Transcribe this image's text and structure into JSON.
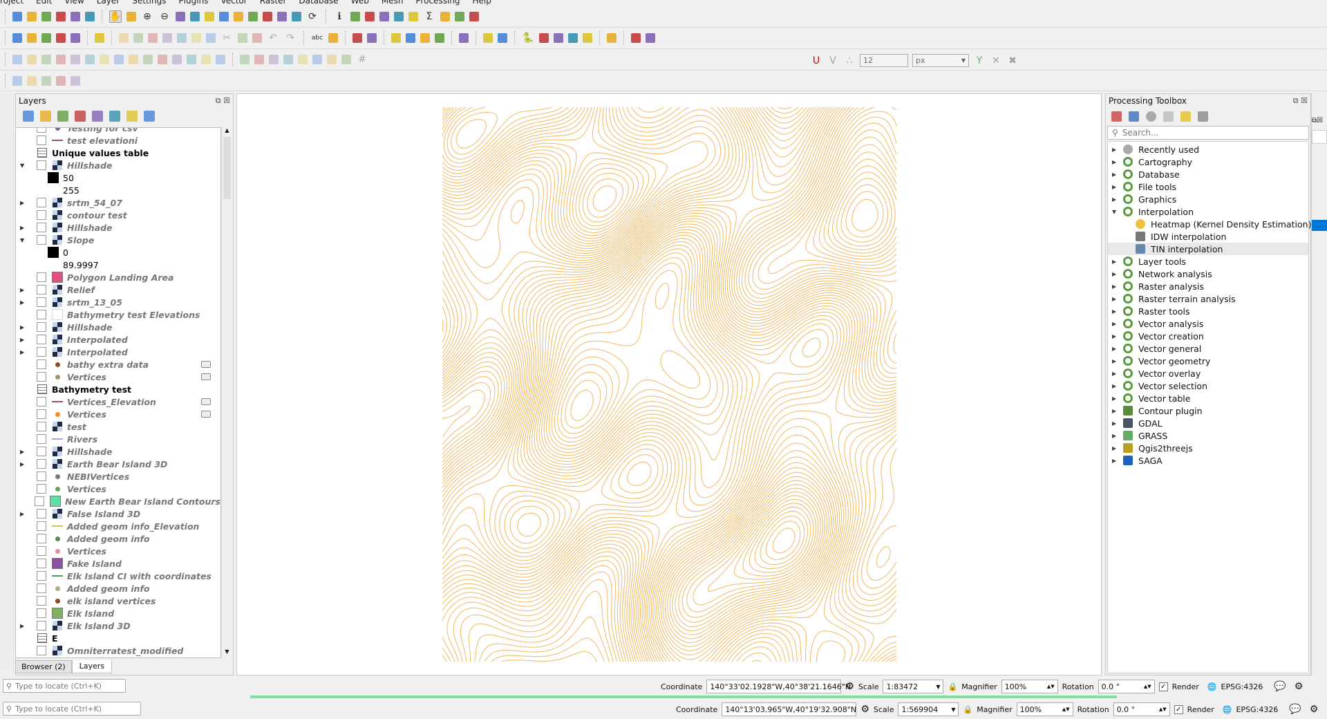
{
  "menu": [
    "roject",
    "Edit",
    "View",
    "Layer",
    "Settings",
    "Plugins",
    "Vector",
    "Raster",
    "Database",
    "Web",
    "Mesh",
    "Processing",
    "Help"
  ],
  "toolbars": {
    "row1": [
      "new-project",
      "open-project",
      "save-project",
      "save-as",
      "print-layout",
      "style-manager",
      "|",
      "pan-hand",
      "pan-to-selection",
      "zoom-in",
      "zoom-out",
      "zoom-full",
      "zoom-selection",
      "zoom-layer",
      "zoom-native",
      "zoom-last",
      "zoom-next",
      "new-bookmark",
      "show-bookmarks",
      "temporal",
      "refresh",
      "|",
      "identify",
      "actions",
      "select-features",
      "open-attribute-table",
      "deselect",
      "statistics",
      "sum",
      "measure",
      "map-tips",
      "text-annotation"
    ],
    "row2": [
      "data-source-manager",
      "new-geopackage",
      "new-vector",
      "digitize",
      "new-temp-layer",
      "|",
      "georeferencer",
      "|",
      "current-edits",
      "toggle-editing",
      "save-edits",
      "add-feature",
      "vertex-tool",
      "modify-attributes",
      "delete-selected",
      "cut",
      "copy",
      "paste",
      "undo",
      "redo",
      "|",
      "label",
      "diagram",
      "|",
      "pin-labels",
      "show-hide-labels",
      "|",
      "move-label",
      "rotate-label",
      "change-label",
      "label-properties",
      "|",
      "db-manager",
      "|",
      "qgis2threejs",
      "3d-view",
      "|",
      "python",
      "processing",
      "grass",
      "globe",
      "osm-place",
      "|",
      "info",
      "|",
      "coordinate-capture",
      "gps"
    ],
    "row3": [
      "advanced-digitize",
      "vertex",
      "reshape",
      "offset",
      "split",
      "merge",
      "rotate",
      "simplify",
      "add-ring",
      "add-part",
      "fill-ring",
      "delete-ring",
      "delete-part",
      "split-parts",
      "reverse",
      "|",
      "align",
      "align-right",
      "align-left",
      "align-text",
      "light",
      "light2",
      "highlight",
      "highlight2",
      "grid"
    ],
    "row3_right": {
      "tool_icons": [
        "snapping-magnet",
        "snap-vertex",
        "snap-tolerance"
      ],
      "tolerance": "12",
      "unit": "px",
      "extra_icons": [
        "topology",
        "intersection",
        "trace"
      ]
    },
    "row4": [
      "select-tool",
      "select-radius",
      "select-polygon",
      "select-freehand",
      "select-value"
    ]
  },
  "layers_panel": {
    "title": "Layers",
    "tool_icons": [
      "style-brush",
      "add-group",
      "manage-visibility",
      "filter",
      "expression-filter",
      "expand-all",
      "collapse-all",
      "remove-layer"
    ],
    "items": [
      {
        "name": "Testing for csv",
        "type": "point",
        "color": "#8060a8",
        "expand": ""
      },
      {
        "name": "test elevationi",
        "type": "line",
        "color": "#a05050",
        "expand": ""
      },
      {
        "name": "Unique values table",
        "type": "group",
        "color": "",
        "expand": ""
      },
      {
        "name": "Hillshade",
        "type": "raster",
        "color": "",
        "expand": "open"
      },
      {
        "name": "50",
        "type": "legend",
        "color": "#000000",
        "expand": ""
      },
      {
        "name": "255",
        "type": "legend",
        "color": "#ffffff",
        "expand": ""
      },
      {
        "name": "srtm_54_07",
        "type": "raster",
        "color": "",
        "expand": "closed"
      },
      {
        "name": "contour test",
        "type": "raster",
        "color": "",
        "expand": ""
      },
      {
        "name": "Hillshade",
        "type": "raster",
        "color": "",
        "expand": "closed"
      },
      {
        "name": "Slope",
        "type": "raster",
        "color": "",
        "expand": "open"
      },
      {
        "name": "0",
        "type": "legend",
        "color": "#000000",
        "expand": ""
      },
      {
        "name": "89.9997",
        "type": "legend",
        "color": "#ffffff",
        "expand": ""
      },
      {
        "name": "Polygon Landing Area",
        "type": "polygon",
        "color": "#e05080",
        "expand": ""
      },
      {
        "name": "Relief",
        "type": "raster",
        "color": "",
        "expand": "closed"
      },
      {
        "name": "srtm_13_05",
        "type": "raster",
        "color": "",
        "expand": "closed"
      },
      {
        "name": "Bathymetry test Elevations",
        "type": "empty",
        "color": "",
        "expand": ""
      },
      {
        "name": "Hillshade",
        "type": "raster",
        "color": "",
        "expand": "closed"
      },
      {
        "name": "Interpolated",
        "type": "raster",
        "color": "",
        "expand": "closed"
      },
      {
        "name": "Interpolated",
        "type": "raster",
        "color": "",
        "expand": "closed"
      },
      {
        "name": "bathy extra data",
        "type": "point",
        "color": "#8a4a2a",
        "expand": "",
        "editable": true
      },
      {
        "name": "Vertices",
        "type": "point",
        "color": "#a09080",
        "expand": "",
        "editable": true
      },
      {
        "name": "Bathymetry test",
        "type": "group",
        "color": "",
        "expand": ""
      },
      {
        "name": "Vertices_Elevation",
        "type": "line",
        "color": "#a05050",
        "expand": "",
        "editable": true
      },
      {
        "name": "Vertices",
        "type": "point",
        "color": "#f09020",
        "expand": "",
        "editable": true
      },
      {
        "name": "test",
        "type": "raster",
        "color": "",
        "expand": ""
      },
      {
        "name": "Rivers",
        "type": "line",
        "color": "#9aaae0",
        "expand": ""
      },
      {
        "name": "Hillshade",
        "type": "raster",
        "color": "",
        "expand": "closed"
      },
      {
        "name": "Earth Bear Island 3D",
        "type": "raster",
        "color": "",
        "expand": "closed"
      },
      {
        "name": "NEBIVertices",
        "type": "point",
        "color": "#708070",
        "expand": ""
      },
      {
        "name": "Vertices",
        "type": "point",
        "color": "#70a060",
        "expand": ""
      },
      {
        "name": "New Earth Bear Island Contours",
        "type": "polygon",
        "color": "#60e0a0",
        "expand": ""
      },
      {
        "name": "False Island 3D",
        "type": "raster",
        "color": "",
        "expand": "closed"
      },
      {
        "name": "Added geom info_Elevation",
        "type": "line",
        "color": "#d0c050",
        "expand": ""
      },
      {
        "name": "Added geom info",
        "type": "point",
        "color": "#608060",
        "expand": ""
      },
      {
        "name": "Vertices",
        "type": "point",
        "color": "#e090a0",
        "expand": ""
      },
      {
        "name": "Fake Island",
        "type": "polygon",
        "color": "#9050a0",
        "expand": ""
      },
      {
        "name": "Elk Island CI with coordinates",
        "type": "line",
        "color": "#50a050",
        "expand": ""
      },
      {
        "name": "Added geom info",
        "type": "point",
        "color": "#b0a890",
        "expand": ""
      },
      {
        "name": "elk island vertices",
        "type": "point",
        "color": "#8a4a20",
        "expand": ""
      },
      {
        "name": "Elk Island",
        "type": "polygon",
        "color": "#80b060",
        "expand": ""
      },
      {
        "name": "Elk Island 3D",
        "type": "raster",
        "color": "",
        "expand": "closed"
      },
      {
        "name": "E",
        "type": "group",
        "color": "",
        "expand": ""
      },
      {
        "name": "Omniterratest_modified",
        "type": "raster",
        "color": "",
        "expand": ""
      }
    ],
    "tabs": [
      "Browser (2)",
      "Layers"
    ],
    "active_tab": "Layers"
  },
  "map": {
    "contour_color": "#f0b860"
  },
  "toolbox": {
    "title": "Processing Toolbox",
    "tool_icons": [
      "models",
      "python-scripts",
      "history",
      "results",
      "edit-features-in-place",
      "options"
    ],
    "search_placeholder": "Search...",
    "items": [
      {
        "label": "Recently used",
        "icon": "clock",
        "expand": "closed",
        "level": 0
      },
      {
        "label": "Cartography",
        "icon": "qgis",
        "expand": "closed",
        "level": 0
      },
      {
        "label": "Database",
        "icon": "qgis",
        "expand": "closed",
        "level": 0
      },
      {
        "label": "File tools",
        "icon": "qgis",
        "expand": "closed",
        "level": 0
      },
      {
        "label": "Graphics",
        "icon": "qgis",
        "expand": "closed",
        "level": 0
      },
      {
        "label": "Interpolation",
        "icon": "qgis",
        "expand": "open",
        "level": 0
      },
      {
        "label": "Heatmap (Kernel Density Estimation)",
        "icon": "heatmap",
        "expand": "",
        "level": 1
      },
      {
        "label": "IDW interpolation",
        "icon": "idw",
        "expand": "",
        "level": 1
      },
      {
        "label": "TIN interpolation",
        "icon": "tin",
        "expand": "",
        "level": 1,
        "selected": true
      },
      {
        "label": "Layer tools",
        "icon": "qgis",
        "expand": "closed",
        "level": 0
      },
      {
        "label": "Network analysis",
        "icon": "qgis",
        "expand": "closed",
        "level": 0
      },
      {
        "label": "Raster analysis",
        "icon": "qgis",
        "expand": "closed",
        "level": 0
      },
      {
        "label": "Raster terrain analysis",
        "icon": "qgis",
        "expand": "closed",
        "level": 0
      },
      {
        "label": "Raster tools",
        "icon": "qgis",
        "expand": "closed",
        "level": 0
      },
      {
        "label": "Vector analysis",
        "icon": "qgis",
        "expand": "closed",
        "level": 0
      },
      {
        "label": "Vector creation",
        "icon": "qgis",
        "expand": "closed",
        "level": 0
      },
      {
        "label": "Vector general",
        "icon": "qgis",
        "expand": "closed",
        "level": 0
      },
      {
        "label": "Vector geometry",
        "icon": "qgis",
        "expand": "closed",
        "level": 0
      },
      {
        "label": "Vector overlay",
        "icon": "qgis",
        "expand": "closed",
        "level": 0
      },
      {
        "label": "Vector selection",
        "icon": "qgis",
        "expand": "closed",
        "level": 0
      },
      {
        "label": "Vector table",
        "icon": "qgis",
        "expand": "closed",
        "level": 0
      },
      {
        "label": "Contour plugin",
        "icon": "contour",
        "expand": "closed",
        "level": 0
      },
      {
        "label": "GDAL",
        "icon": "gdal",
        "expand": "closed",
        "level": 0
      },
      {
        "label": "GRASS",
        "icon": "grass",
        "expand": "closed",
        "level": 0
      },
      {
        "label": "Qgis2threejs",
        "icon": "threejs",
        "expand": "closed",
        "level": 0
      },
      {
        "label": "SAGA",
        "icon": "saga",
        "expand": "closed",
        "level": 0
      }
    ]
  },
  "statusbars": [
    {
      "locate_placeholder": "Type to locate (Ctrl+K)",
      "coordinate_label": "Coordinate",
      "coordinate": "140°33'02.1928\"W,40°38'21.1646\"N",
      "scale_label": "Scale",
      "scale": "1:83472",
      "magnifier_label": "Magnifier",
      "magnifier": "100%",
      "rotation_label": "Rotation",
      "rotation": "0.0 °",
      "render_label": "Render",
      "render": true,
      "crs": "EPSG:4326"
    },
    {
      "locate_placeholder": "Type to locate (Ctrl+K)",
      "coordinate_label": "Coordinate",
      "coordinate": "140°13'03.965\"W,40°19'32.908\"N",
      "scale_label": "Scale",
      "scale": "1:569904",
      "magnifier_label": "Magnifier",
      "magnifier": "100%",
      "rotation_label": "Rotation",
      "rotation": "0.0 °",
      "render_label": "Render",
      "render": true,
      "crs": "EPSG:4326"
    }
  ],
  "progress": 1.0
}
